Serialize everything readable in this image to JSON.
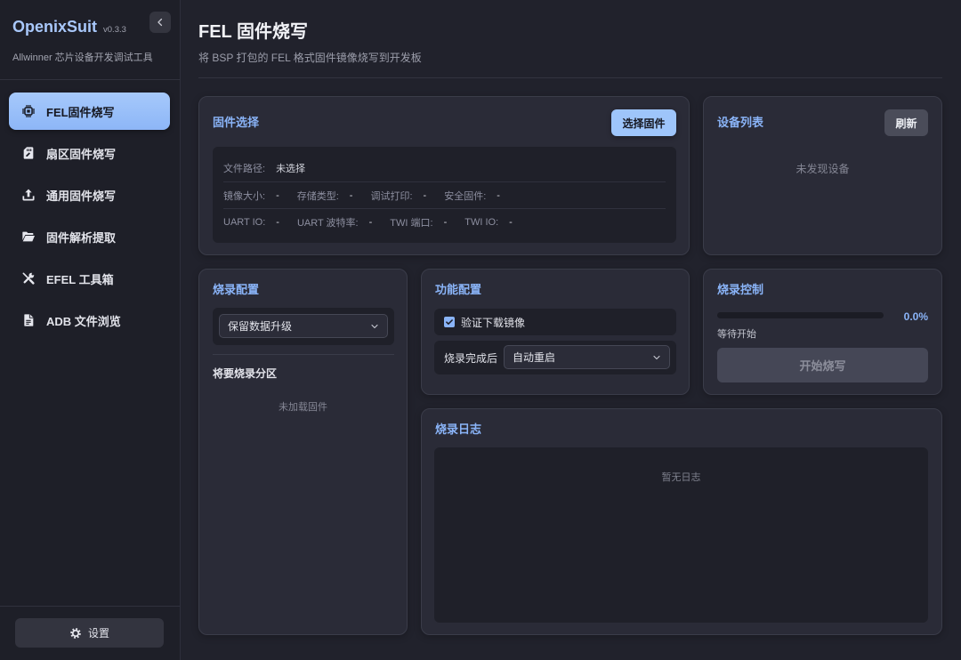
{
  "theme": {
    "accent": "#8ab4f8"
  },
  "app": {
    "name": "OpenixSuit",
    "version": "v0.3.3",
    "subtitle": "Allwinner 芯片设备开发调试工具",
    "collapse_icon": "chevron-left-icon"
  },
  "sidebar": {
    "items": [
      {
        "label": "FEL固件烧写",
        "icon": "chip-icon",
        "active": true
      },
      {
        "label": "扇区固件烧写",
        "icon": "sd-card-icon",
        "active": false
      },
      {
        "label": "通用固件烧写",
        "icon": "upload-icon",
        "active": false
      },
      {
        "label": "固件解析提取",
        "icon": "folder-open-icon",
        "active": false
      },
      {
        "label": "EFEL 工具箱",
        "icon": "tools-icon",
        "active": false
      },
      {
        "label": "ADB 文件浏览",
        "icon": "file-icon",
        "active": false
      }
    ],
    "settings": {
      "label": "设置",
      "icon": "gear-icon"
    }
  },
  "page": {
    "title": "FEL 固件烧写",
    "subtitle": "将 BSP 打包的 FEL 格式固件镜像烧写到开发板"
  },
  "firmware": {
    "title": "固件选择",
    "select_button": "选择固件",
    "path": {
      "label": "文件路径:",
      "value": "未选择"
    },
    "info_rows": [
      [
        {
          "label": "镜像大小:",
          "value": "-"
        },
        {
          "label": "存储类型:",
          "value": "-"
        },
        {
          "label": "调试打印:",
          "value": "-"
        },
        {
          "label": "安全固件:",
          "value": "-"
        }
      ],
      [
        {
          "label": "UART IO:",
          "value": "-"
        },
        {
          "label": "UART 波特率:",
          "value": "-"
        },
        {
          "label": "TWI 端口:",
          "value": "-"
        },
        {
          "label": "TWI IO:",
          "value": "-"
        }
      ]
    ]
  },
  "devices": {
    "title": "设备列表",
    "refresh_button": "刷新",
    "empty_text": "未发现设备"
  },
  "flash_config": {
    "title": "烧录配置",
    "mode": "保留数据升级",
    "partitions_title": "将要烧录分区",
    "partitions_empty": "未加载固件"
  },
  "features": {
    "title": "功能配置",
    "verify_label": "验证下载镜像",
    "verify_checked": true,
    "after_flash_label": "烧录完成后",
    "after_flash_value": "自动重启"
  },
  "control": {
    "title": "烧录控制",
    "progress": 0,
    "progress_text": "0.0%",
    "status": "等待开始",
    "start_button": "开始烧写",
    "start_enabled": false
  },
  "log": {
    "title": "烧录日志",
    "empty_text": "暂无日志"
  }
}
